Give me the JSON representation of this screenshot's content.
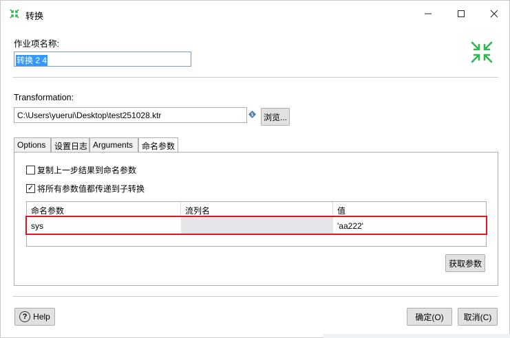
{
  "window": {
    "title": "转换"
  },
  "job": {
    "name_label": "作业项名称:",
    "name_value": "转换 2 4"
  },
  "transformation": {
    "label": "Transformation:",
    "path": "C:\\Users\\yuerui\\Desktop\\test251028.ktr",
    "browse_label": "浏览..."
  },
  "tabs": [
    {
      "label": "Options"
    },
    {
      "label": "设置日志"
    },
    {
      "label": "Arguments"
    },
    {
      "label": "命名参数"
    }
  ],
  "params": {
    "copy_results_label": "复制上一步结果到命名参数",
    "copy_results_checked": false,
    "pass_all_label": "将所有参数值都传递到子转换",
    "pass_all_checked": true,
    "pass_all_mark": "✓",
    "columns": [
      "命名参数",
      "流列名",
      "值"
    ],
    "rows": [
      {
        "name": "sys",
        "stream_col": "",
        "value": "'aa222'"
      }
    ],
    "get_params_label": "获取参数"
  },
  "footer": {
    "help_label": "Help",
    "help_glyph": "?",
    "ok_label": "确定(O)",
    "cancel_label": "取消(C)"
  },
  "colors": {
    "highlight": "#e0141e",
    "brand": "#2db84d",
    "selection": "#3399ff"
  }
}
